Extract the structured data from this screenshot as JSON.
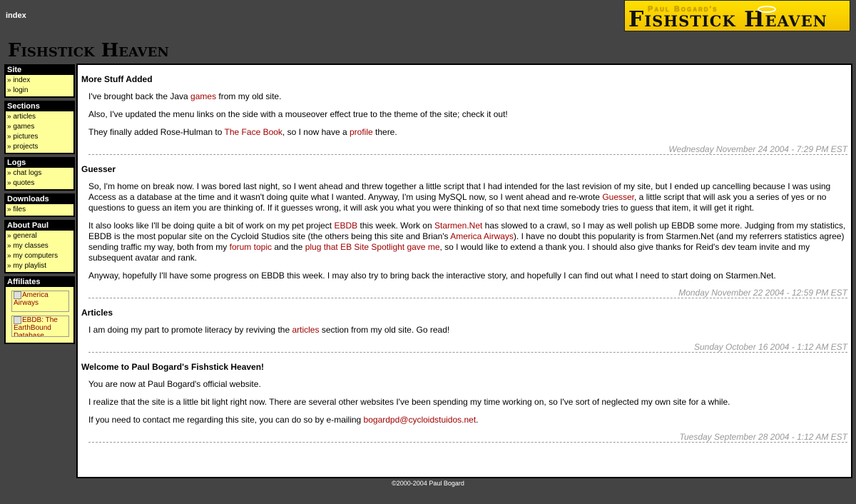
{
  "header": {
    "breadcrumb": "index",
    "banner_byline": "Paul Bogard's",
    "banner_title": "Fishstick Heaven",
    "site_title": "Fishstick Heaven"
  },
  "sidebar": {
    "groups": [
      {
        "title": "Site",
        "items": [
          "» index",
          "» login"
        ]
      },
      {
        "title": "Sections",
        "items": [
          "» articles",
          "» games",
          "» pictures",
          "» projects"
        ]
      },
      {
        "title": "Logs",
        "items": [
          "» chat logs",
          "» quotes"
        ]
      },
      {
        "title": "Downloads",
        "items": [
          "» files"
        ]
      },
      {
        "title": "About Paul",
        "items": [
          "» general",
          "» my classes",
          "» my computers",
          "» my playlist"
        ]
      }
    ],
    "affiliates": {
      "title": "Affiliates",
      "items": [
        "America Airways",
        "EBDB: The EarthBound Database"
      ]
    }
  },
  "posts": [
    {
      "title": "More Stuff Added",
      "p1": {
        "a": "I've brought back the Java ",
        "l1": "games",
        "b": " from my old site."
      },
      "p2": "Also, I've updated the menu links on the side with a mouseover effect true to the theme of the site; check it out!",
      "p3": {
        "a": "They finally added Rose-Hulman to ",
        "l1": "The Face Book",
        "b": ", so I now have a ",
        "l2": "profile",
        "c": " there."
      },
      "date": "Wednesday November 24 2004 - 7:29 PM EST"
    },
    {
      "title": "Guesser",
      "p1": {
        "a": "So, I'm home on break now. I was bored last night, so I went ahead and threw together a little script that I had intended for the last revision of my site, but I ended up cancelling because I was using Access as a database at the time and it wasn't doing quite what I wanted. Anyway, I'm using MySQL now, so I went ahead and re-wrote ",
        "l1": "Guesser",
        "b": ", a little script that will ask you a series of yes or no questions to guess an item you are thinking of. If it guesses wrong, it will ask you what you were thinking of so that next time somebody tries to guess that item, it will get it right."
      },
      "p2": {
        "a": "It also looks like I'll be doing quite a bit of work on my pet project ",
        "l1": "EBDB",
        "b": " this week. Work on ",
        "l2": "Starmen.Net",
        "c": " has slowed to a crawl, so I may as well polish up EBDB some more. Judging from my statistics, EBDB is the most popular site on the Cycloid Studios site (the others being this site and Brian's ",
        "l3": "America Airways",
        "d": "). I have no doubt this popularity is from Starmen.Net (and my referrers statistics agree) sending traffic my way, both from my ",
        "l4": "forum topic",
        "e": " and the ",
        "l5": "plug that EB Site Spotlight gave me",
        "f": ", so I would like to extend a thank you. I should also give thanks for Reid's dev team invite and my subsequent avatar and rank."
      },
      "p3": "Anyway, hopefully I'll have some progress on EBDB this week. I may also try to bring back the interactive story, and hopefully I can find out what I need to start doing on Starmen.Net.",
      "date": "Monday November 22 2004 - 12:59 PM EST"
    },
    {
      "title": "Articles",
      "p1": {
        "a": "I am doing my part to promote literacy by reviving the ",
        "l1": "articles",
        "b": " section from my old site. Go read!"
      },
      "date": "Sunday October 16 2004 - 1:12 AM EST"
    },
    {
      "title": "Welcome to Paul Bogard's Fishstick Heaven!",
      "p1": "You are now at Paul Bogard's official website.",
      "p2": "I realize that the site is a little bit light right now. There are several other websites I've been spending my time working on, so I've sort of neglected my own site for a while.",
      "p3": {
        "a": "If you need to contact me regarding this site, you can do so by e-mailing ",
        "l1": "bogardpd@cycloidstuidos.net",
        "b": "."
      },
      "date": "Tuesday September 28 2004 - 1:12 AM EST"
    }
  ],
  "footer": "©2000-2004 Paul Bogard",
  "colors": {
    "background": "#444444",
    "menu_bg": "#ffff99",
    "link": "#a00000",
    "banner": "#ffe000"
  }
}
